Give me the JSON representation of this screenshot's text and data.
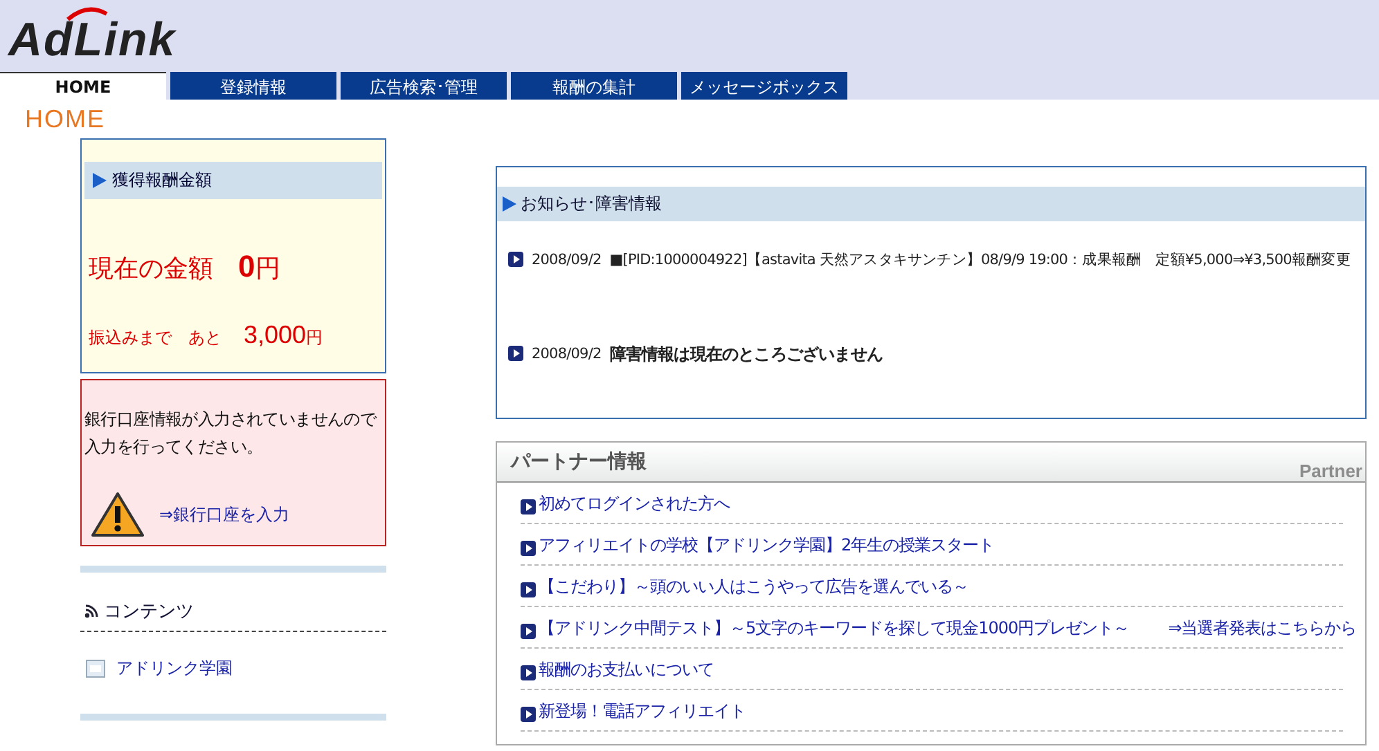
{
  "logo": "AdLink",
  "tabs": [
    {
      "label": "HOME",
      "selected": true
    },
    {
      "label": "登録情報",
      "selected": false
    },
    {
      "label": "広告検索･管理",
      "selected": false
    },
    {
      "label": "報酬の集計",
      "selected": false
    },
    {
      "label": "メッセージボックス",
      "selected": false
    }
  ],
  "page_title": "HOME",
  "earnings": {
    "heading": "獲得報酬金額",
    "current_label": "現在の金額",
    "current_value": "0",
    "current_unit": "円",
    "transfer_label": "振込みまで　あと",
    "transfer_value": "3,000",
    "transfer_unit": "円"
  },
  "bank_alert": {
    "message": "銀行口座情報が入力されていませんので入力を行ってください。",
    "link": "⇒銀行口座を入力"
  },
  "contents": {
    "heading": "コンテンツ",
    "items": [
      "アドリンク学園"
    ]
  },
  "news": {
    "heading": "お知らせ･障害情報",
    "items": [
      {
        "date": "2008/09/2",
        "text": "■[PID:1000004922]【astavita 天然アスタキサンチン】08/9/9 19:00：成果報酬　定額¥5,000⇒¥3,500報酬変更",
        "bold": false
      },
      {
        "date": "2008/09/2",
        "text": "障害情報は現在のところございません",
        "bold": true
      }
    ]
  },
  "partner": {
    "heading": "パートナー情報",
    "subheading": "Partner",
    "items": [
      {
        "text": "初めてログインされた方へ"
      },
      {
        "text": "アフィリエイトの学校【アドリンク学園】2年生の授業スタート"
      },
      {
        "text": "【こだわり】～頭のいい人はこうやって広告を選んでいる～"
      },
      {
        "text": "【アドリンク中間テスト】～5文字のキーワードを探して現金1000円プレゼント～",
        "extra": "⇒当選者発表はこちらから"
      },
      {
        "text": "報酬のお支払いについて"
      },
      {
        "text": "新登場！電話アフィリエイト"
      }
    ]
  }
}
